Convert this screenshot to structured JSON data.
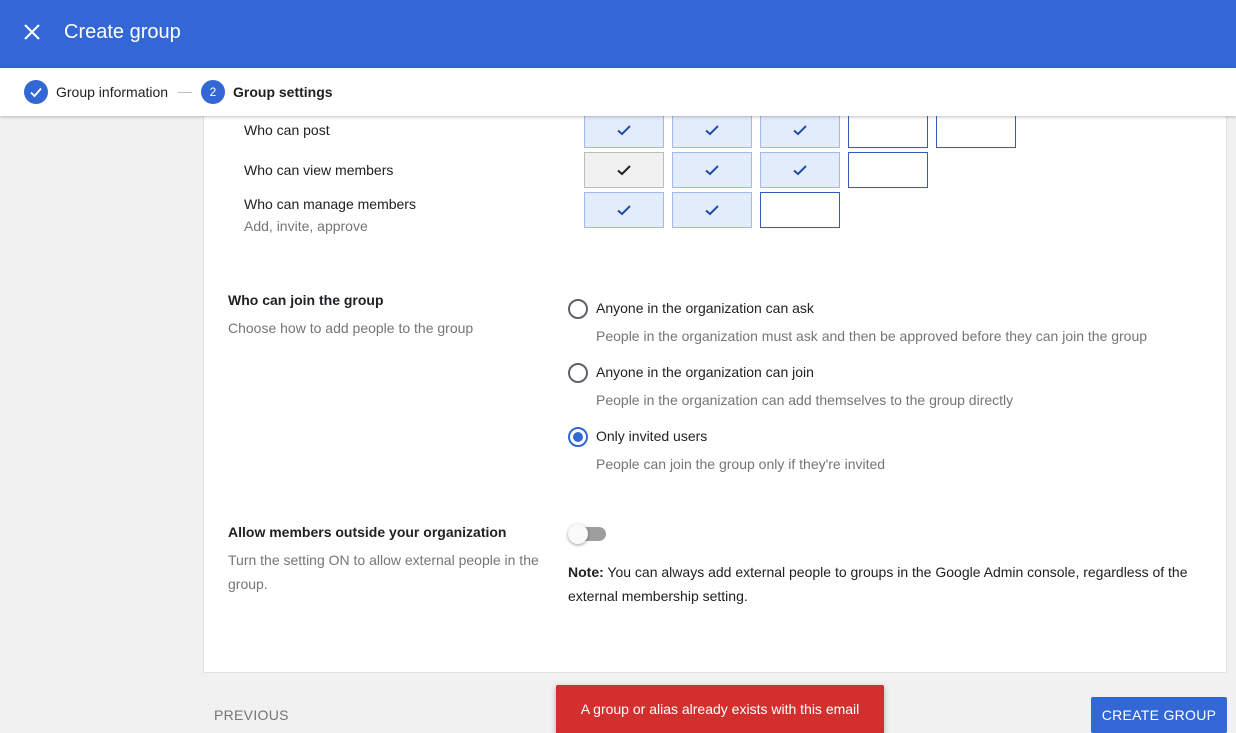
{
  "header": {
    "title": "Create group",
    "close_icon": "close-icon",
    "color": "#3367d6"
  },
  "stepper": {
    "steps": [
      {
        "label": "Group information",
        "state": "completed",
        "icon": "check-icon"
      },
      {
        "label": "Group settings",
        "state": "active",
        "number": "2"
      }
    ]
  },
  "permissions": {
    "rows": [
      {
        "label": "Who can post",
        "sub": "",
        "cells": [
          "checked",
          "checked",
          "checked",
          "empty",
          "empty"
        ]
      },
      {
        "label": "Who can view members",
        "sub": "",
        "cells": [
          "checked-disabled",
          "checked",
          "checked",
          "empty"
        ]
      },
      {
        "label": "Who can manage members",
        "sub": "Add, invite, approve",
        "cells": [
          "checked",
          "checked",
          "empty"
        ]
      }
    ]
  },
  "join": {
    "title": "Who can join the group",
    "description": "Choose how to add people to the group",
    "options": [
      {
        "label": "Anyone in the organization can ask",
        "description": "People in the organization must ask and then be approved before they can join the group",
        "selected": false
      },
      {
        "label": "Anyone in the organization can join",
        "description": "People in the organization can add themselves to the group directly",
        "selected": false
      },
      {
        "label": "Only invited users",
        "description": "People can join the group only if they're invited",
        "selected": true
      }
    ]
  },
  "external": {
    "title": "Allow members outside your organization",
    "description": "Turn the setting ON to allow external people in the group.",
    "toggle_on": false,
    "note_label": "Note:",
    "note_text": " You can always add external people to groups in the Google Admin console, regardless of the external membership setting."
  },
  "footer": {
    "previous_label": "PREVIOUS",
    "create_label": "CREATE GROUP"
  },
  "snackbar": {
    "message": "A group or alias already exists with this email",
    "color": "#d32f2f"
  }
}
